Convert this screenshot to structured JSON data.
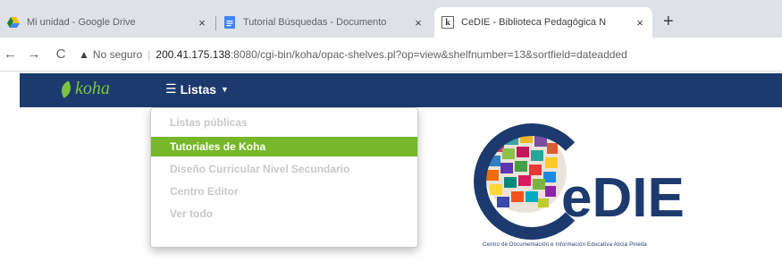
{
  "browser": {
    "tabs": [
      {
        "title": "Mi unidad - Google Drive",
        "icon": "google-drive-icon"
      },
      {
        "title": "Tutorial Búsquedas - Documento",
        "icon": "google-docs-icon"
      },
      {
        "title": "CeDIE - Biblioteca Pedagógica N",
        "icon": "koha-favicon",
        "active": true
      }
    ],
    "close_glyph": "×",
    "new_tab_glyph": "+",
    "not_secure_label": "No seguro",
    "url_host": "200.41.175.138",
    "url_rest": ":8080/cgi-bin/koha/opac-shelves.pl?op=view&shelfnumber=13&sortfield=dateadded"
  },
  "koha": {
    "brand": "koha",
    "menu_label": "Listas",
    "dropdown": {
      "items": [
        {
          "label": "Listas públicas",
          "active": false
        },
        {
          "label": "Tutoriales de Koha",
          "active": true
        },
        {
          "label": "Diseño Curricular Nivel Secundario",
          "active": false
        },
        {
          "label": "Centro Editor",
          "active": false
        },
        {
          "label": "Ver todo",
          "active": false
        }
      ]
    }
  },
  "logo": {
    "letters_c": "C",
    "letters_rest": "eDIE",
    "caption": "Centro de Documentación e Información Educativa Alicia Pineda"
  },
  "colors": {
    "navbar": "#1c3a6e",
    "brand_green": "#7cc43f",
    "menu_active": "#76b82a"
  }
}
